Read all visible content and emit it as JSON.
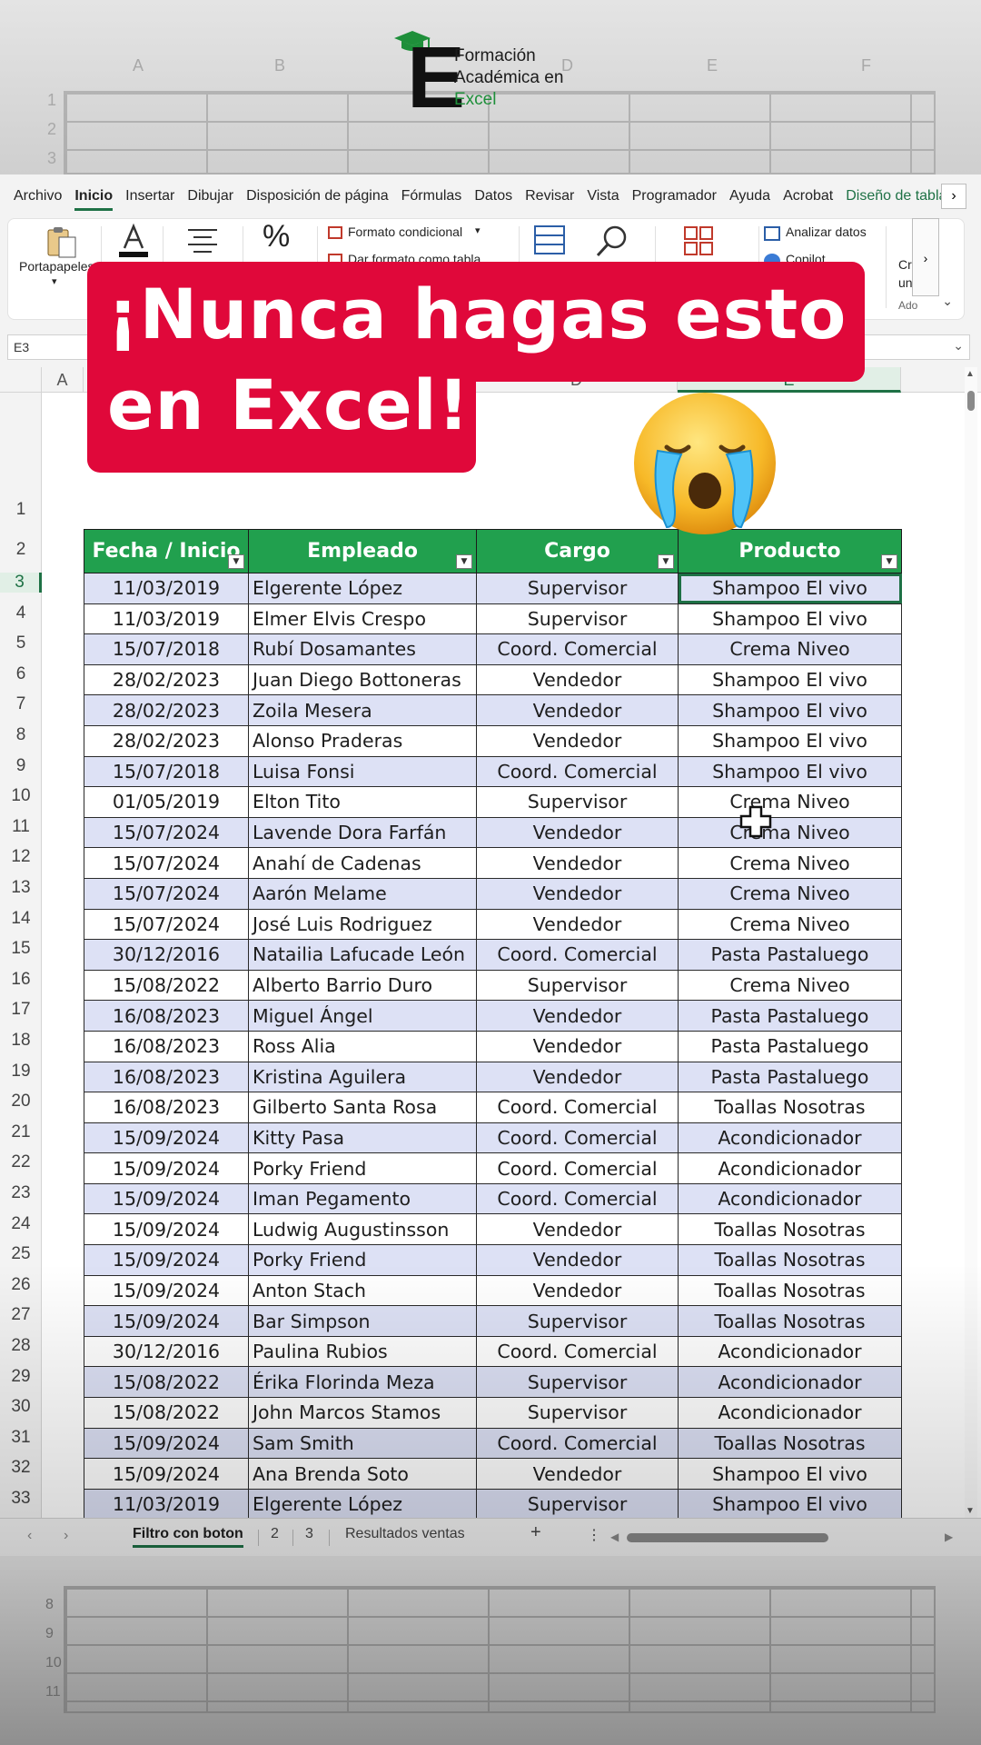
{
  "brand": {
    "line1": "Formación",
    "line2": "Académica en",
    "line3": "Excel"
  },
  "background_labels": {
    "cols": [
      "A",
      "B",
      "D",
      "E",
      "F"
    ],
    "rows_top": [
      "1",
      "2",
      "3"
    ],
    "rows_bottom": [
      "8",
      "9",
      "10",
      "11"
    ]
  },
  "menu": {
    "items": [
      "Archivo",
      "Inicio",
      "Insertar",
      "Dibujar",
      "Disposición de página",
      "Fórmulas",
      "Datos",
      "Revisar",
      "Vista",
      "Programador",
      "Ayuda",
      "Acrobat",
      "Diseño de tabla"
    ],
    "active_index": 1,
    "more": "›"
  },
  "ribbon": {
    "clipboard_label": "Portapapeles",
    "conditional_format": "Formato condicional",
    "format_as_table": "Dar formato como tabla",
    "analyze_data": "Analizar datos",
    "copilot": "Copilot",
    "create_1": "Cr",
    "create_2": "un",
    "addins": "Ado"
  },
  "formula_bar": {
    "name_box": "E3",
    "value": ""
  },
  "columns": [
    "A",
    "D",
    "E"
  ],
  "active_cell": "E3",
  "headline": "¡Nunca hagas esto en Excel!",
  "headline_line1": "¡Nunca hagas esto",
  "headline_line2": "en Excel!",
  "table": {
    "headers": [
      "Fecha / Inicio",
      "Empleado",
      "Cargo",
      "Producto"
    ],
    "rows": [
      [
        "11/03/2019",
        "Elgerente López",
        "Supervisor",
        "Shampoo El vivo"
      ],
      [
        "11/03/2019",
        "Elmer Elvis Crespo",
        "Supervisor",
        "Shampoo El vivo"
      ],
      [
        "15/07/2018",
        "Rubí Dosamantes",
        "Coord. Comercial",
        "Crema Niveo"
      ],
      [
        "28/02/2023",
        "Juan Diego Bottoneras",
        "Vendedor",
        "Shampoo El vivo"
      ],
      [
        "28/02/2023",
        "Zoila Mesera",
        "Vendedor",
        "Shampoo El vivo"
      ],
      [
        "28/02/2023",
        "Alonso Praderas",
        "Vendedor",
        "Shampoo El vivo"
      ],
      [
        "15/07/2018",
        "Luisa Fonsi",
        "Coord. Comercial",
        "Shampoo El vivo"
      ],
      [
        "01/05/2019",
        "Elton Tito",
        "Supervisor",
        "Crema Niveo"
      ],
      [
        "15/07/2024",
        "Lavende Dora Farfán",
        "Vendedor",
        "Crema Niveo"
      ],
      [
        "15/07/2024",
        "Anahí de Cadenas",
        "Vendedor",
        "Crema Niveo"
      ],
      [
        "15/07/2024",
        "Aarón Melame",
        "Vendedor",
        "Crema Niveo"
      ],
      [
        "15/07/2024",
        "José Luis Rodriguez",
        "Vendedor",
        "Crema Niveo"
      ],
      [
        "30/12/2016",
        "Natailia Lafucade León",
        "Coord. Comercial",
        "Pasta Pastaluego"
      ],
      [
        "15/08/2022",
        "Alberto Barrio Duro",
        "Supervisor",
        "Crema Niveo"
      ],
      [
        "16/08/2023",
        "Miguel Ángel",
        "Vendedor",
        "Pasta Pastaluego"
      ],
      [
        "16/08/2023",
        "Ross Alia",
        "Vendedor",
        "Pasta Pastaluego"
      ],
      [
        "16/08/2023",
        "Kristina Aguilera",
        "Vendedor",
        "Pasta Pastaluego"
      ],
      [
        "16/08/2023",
        "Gilberto Santa Rosa",
        "Coord. Comercial",
        "Toallas Nosotras"
      ],
      [
        "15/09/2024",
        "Kitty Pasa",
        "Coord. Comercial",
        "Acondicionador"
      ],
      [
        "15/09/2024",
        "Porky Friend",
        "Coord. Comercial",
        "Acondicionador"
      ],
      [
        "15/09/2024",
        "Iman Pegamento",
        "Coord. Comercial",
        "Acondicionador"
      ],
      [
        "15/09/2024",
        "Ludwig Augustinsson",
        "Vendedor",
        "Toallas Nosotras"
      ],
      [
        "15/09/2024",
        "Porky Friend",
        "Vendedor",
        "Toallas Nosotras"
      ],
      [
        "15/09/2024",
        "Anton Stach",
        "Vendedor",
        "Toallas Nosotras"
      ],
      [
        "15/09/2024",
        "Bar Simpson",
        "Supervisor",
        "Toallas Nosotras"
      ],
      [
        "30/12/2016",
        "Paulina Rubios",
        "Coord. Comercial",
        "Acondicionador"
      ],
      [
        "15/08/2022",
        "Érika Florinda Meza",
        "Supervisor",
        "Acondicionador"
      ],
      [
        "15/08/2022",
        "John Marcos Stamos",
        "Supervisor",
        "Acondicionador"
      ],
      [
        "15/09/2024",
        "Sam Smith",
        "Coord. Comercial",
        "Toallas Nosotras"
      ],
      [
        "15/09/2024",
        "Ana Brenda Soto",
        "Vendedor",
        "Shampoo El vivo"
      ],
      [
        "11/03/2019",
        "Elgerente López",
        "Supervisor",
        "Shampoo El vivo"
      ]
    ]
  },
  "sheet_tabs": {
    "tabs": [
      "Filtro con boton",
      "2",
      "3",
      "Resultados ventas"
    ],
    "active_index": 0,
    "add": "+",
    "more": "⋮"
  },
  "colors": {
    "header_green": "#21a04e",
    "banner_red": "#e0083a",
    "band_row": "#dde1f5",
    "excel_green": "#1e7145"
  }
}
